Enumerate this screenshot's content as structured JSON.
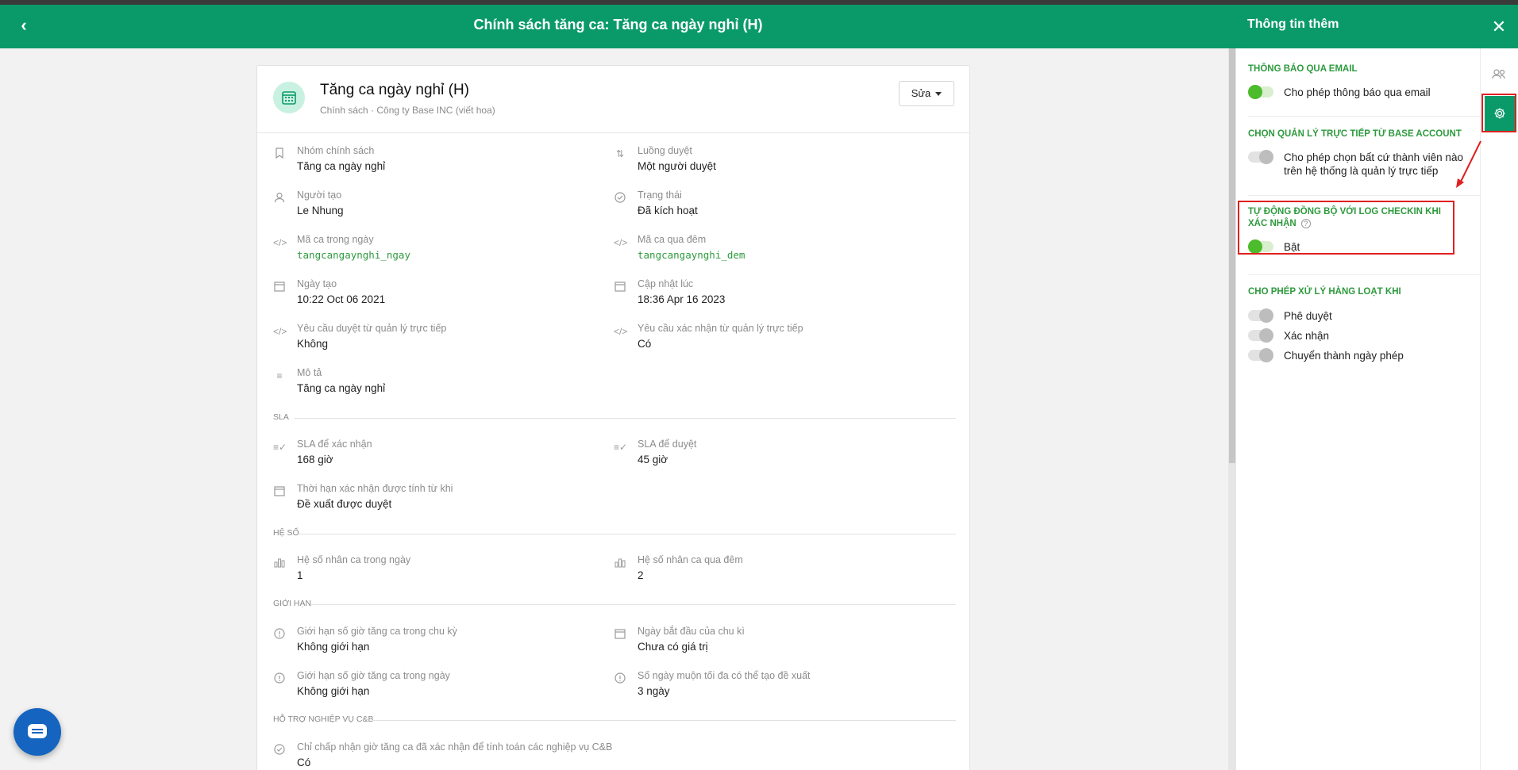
{
  "header": {
    "title": "Chính sách tăng ca: Tăng ca ngày nghỉ (H)",
    "back_icon": "chevron-left-icon"
  },
  "card": {
    "title": "Tăng ca ngày nghỉ (H)",
    "subtitle": "Chính sách · Công ty Base INC (viết hoa)",
    "edit_label": "Sửa",
    "fields": [
      {
        "label": "Nhóm chính sách",
        "value": "Tăng ca ngày nghỉ"
      },
      {
        "label": "Luồng duyệt",
        "value": "Một người duyệt"
      },
      {
        "label": "Người tạo",
        "value": "Le Nhung"
      },
      {
        "label": "Trạng thái",
        "value": "Đã kích hoạt"
      },
      {
        "label": "Mã ca trong ngày",
        "value": "tangcangaynghi_ngay"
      },
      {
        "label": "Mã ca qua đêm",
        "value": "tangcangaynghi_dem"
      },
      {
        "label": "Ngày tạo",
        "value": "10:22 Oct 06 2021"
      },
      {
        "label": "Cập nhật lúc",
        "value": "18:36 Apr 16 2023"
      },
      {
        "label": "Yêu cầu duyệt từ quản lý trực tiếp",
        "value": "Không"
      },
      {
        "label": "Yêu cầu xác nhận từ quản lý trực tiếp",
        "value": "Có"
      },
      {
        "label": "Mô tả",
        "value": "Tăng ca ngày nghỉ"
      },
      {
        "label": "SLA để xác nhận",
        "value": "168 giờ"
      },
      {
        "label": "SLA để duyệt",
        "value": "45 giờ"
      },
      {
        "label": "Thời hạn xác nhận được tính từ khi",
        "value": "Đề xuất được duyệt"
      },
      {
        "label": "Hệ số nhân ca trong ngày",
        "value": "1"
      },
      {
        "label": "Hệ số nhân ca qua đêm",
        "value": "2"
      },
      {
        "label": "Giới hạn số giờ tăng ca trong chu kỳ",
        "value": "Không giới hạn"
      },
      {
        "label": "Ngày bắt đầu của chu kì",
        "value": "Chưa có giá trị"
      },
      {
        "label": "Giới hạn số giờ tăng ca trong ngày",
        "value": "Không giới hạn"
      },
      {
        "label": "Số ngày muộn tối đa có thể tạo đề xuất",
        "value": "3 ngày"
      },
      {
        "label": "Chỉ chấp nhận giờ tăng ca đã xác nhận để tính toán các nghiệp vụ C&B",
        "value": "Có"
      }
    ],
    "sections": {
      "sla": "SLA",
      "he_so": "HỆ SỐ",
      "gioi_han": "GIỚI HẠN",
      "ho_tro": "HỖ TRỢ NGHIỆP VỤ C&B"
    }
  },
  "panel": {
    "title": "Thông tin thêm",
    "email_title": "THÔNG BÁO QUA EMAIL",
    "email_toggle": {
      "label": "Cho phép thông báo qua email",
      "on": true
    },
    "manager_title": "CHỌN QUẢN LÝ TRỰC TIẾP TỪ BASE ACCOUNT",
    "manager_toggle": {
      "label_line1": "Cho phép chọn bất cứ thành viên nào",
      "label_line2": "trên hệ thống là quản lý trực tiếp",
      "on": false
    },
    "sync_title_line1": "TỰ ĐỘNG ĐỒNG BỘ VỚI LOG CHECKIN KHI",
    "sync_title_line2": "XÁC NHẬN",
    "sync_toggle": {
      "label": "Bật",
      "on": true
    },
    "bulk_title": "CHO PHÉP XỬ LÝ HÀNG LOẠT KHI",
    "bulk_toggles": [
      {
        "label": "Phê duyệt",
        "on": false
      },
      {
        "label": "Xác nhận",
        "on": false
      },
      {
        "label": "Chuyển thành ngày phép",
        "on": false
      }
    ]
  },
  "colors": {
    "primary": "#0a9a6a",
    "toggle_on": "#4cbb2c",
    "highlight": "#e02020",
    "chat": "#1565c0"
  }
}
